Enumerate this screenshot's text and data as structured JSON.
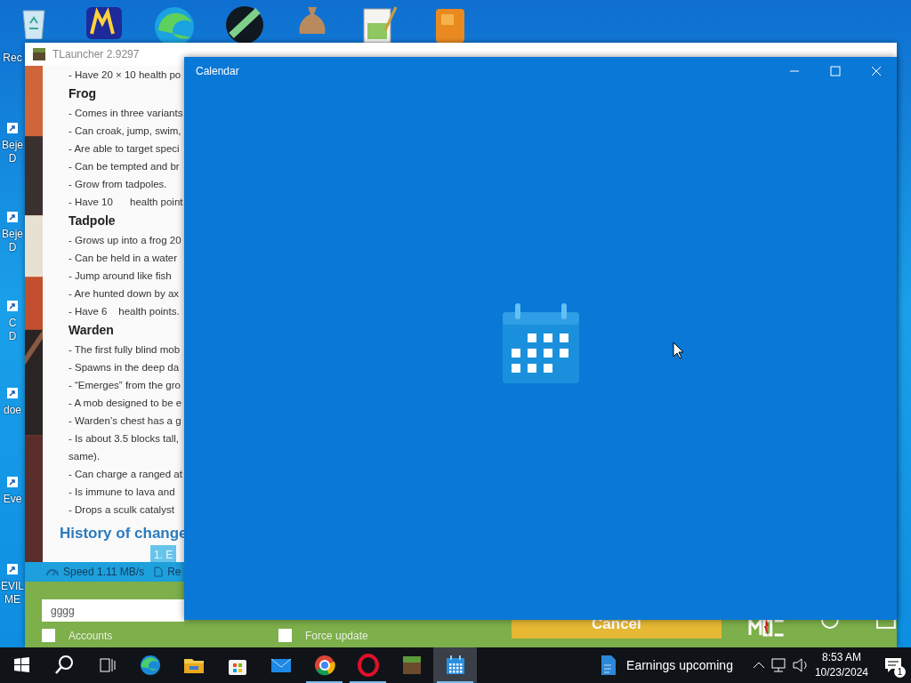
{
  "desktop": {
    "side_icons": [
      {
        "lines": [
          "Rec"
        ],
        "shortcut": false
      },
      {
        "lines": [
          "Beje",
          "D"
        ],
        "shortcut": true
      },
      {
        "lines": [
          "Beje",
          "D"
        ],
        "shortcut": true
      },
      {
        "lines": [
          "C",
          "D"
        ],
        "shortcut": true
      },
      {
        "lines": [
          "doe"
        ],
        "shortcut": true
      },
      {
        "lines": [
          "Eve"
        ],
        "shortcut": true
      },
      {
        "lines": [
          "EVIL",
          "ME"
        ],
        "shortcut": true
      }
    ]
  },
  "tlauncher": {
    "title": "TLauncher 2.9297",
    "article": [
      {
        "kind": "line",
        "text": "- Have 20 × 10 health po"
      },
      {
        "kind": "heading",
        "text": "Frog"
      },
      {
        "kind": "line",
        "text": "- Comes in three variants"
      },
      {
        "kind": "line",
        "text": "- Can croak, jump, swim,"
      },
      {
        "kind": "line",
        "text": "- Are able to target speci"
      },
      {
        "kind": "line",
        "text": "- Can be tempted and br"
      },
      {
        "kind": "line",
        "text": "- Grow from tadpoles."
      },
      {
        "kind": "line",
        "text": "- Have 10      health point"
      },
      {
        "kind": "heading",
        "text": "Tadpole"
      },
      {
        "kind": "line",
        "text": "- Grows up into a frog 20"
      },
      {
        "kind": "line",
        "text": "- Can be held in a water"
      },
      {
        "kind": "line",
        "text": "- Jump around like fish"
      },
      {
        "kind": "line",
        "text": "- Are hunted down by ax"
      },
      {
        "kind": "line",
        "text": "- Have 6    health points."
      },
      {
        "kind": "heading",
        "text": "Warden"
      },
      {
        "kind": "line",
        "text": "- The first fully blind mob"
      },
      {
        "kind": "line",
        "text": "- Spawns in the deep da"
      },
      {
        "kind": "line",
        "text": "- “Emerges” from the gro"
      },
      {
        "kind": "line",
        "text": "- A mob designed to be e"
      },
      {
        "kind": "line",
        "text": "- Warden’s chest has a g"
      },
      {
        "kind": "line",
        "text": "- Is about 3.5 blocks tall,"
      },
      {
        "kind": "line",
        "text": "same)."
      },
      {
        "kind": "line",
        "text": "- Can charge a ranged at"
      },
      {
        "kind": "line",
        "text": "- Is immune to lava and"
      },
      {
        "kind": "line",
        "text": "- Drops a sculk catalyst"
      }
    ],
    "history_heading": "History of change",
    "history_tab": "1. E",
    "status": {
      "speed": "Speed 1.11 MB/s",
      "report": "Re"
    },
    "search_value": "gggg",
    "checkboxes": [
      {
        "label": "Accounts",
        "checked": false
      },
      {
        "label": "Force update",
        "checked": false
      }
    ],
    "cancel_button": "Cancel"
  },
  "calendar_window": {
    "title": "Calendar"
  },
  "taskbar": {
    "apps": [
      {
        "kind": "edge",
        "running": false,
        "selected": false
      },
      {
        "kind": "explorer",
        "running": false,
        "selected": false
      },
      {
        "kind": "store",
        "running": false,
        "selected": false
      },
      {
        "kind": "mail",
        "running": false,
        "selected": false
      },
      {
        "kind": "chrome",
        "running": true,
        "selected": false
      },
      {
        "kind": "opera",
        "running": true,
        "selected": false
      },
      {
        "kind": "minecraft",
        "running": false,
        "selected": false
      },
      {
        "kind": "calendar",
        "running": true,
        "selected": true
      }
    ],
    "widget": "Earnings upcoming",
    "time": "8:53 AM",
    "date": "10/23/2024",
    "notifications": "1"
  }
}
